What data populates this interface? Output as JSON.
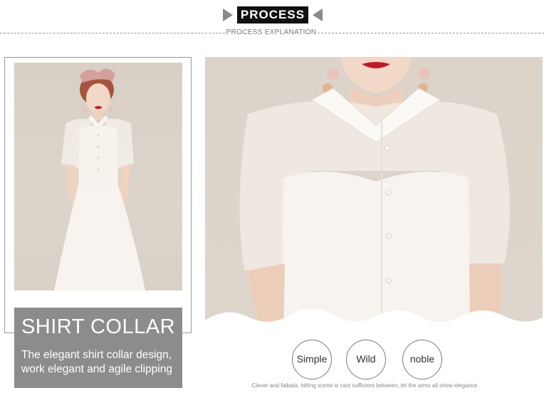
{
  "header": {
    "title": "PROCESS",
    "subtitle": "PROCESS EXPLANATION"
  },
  "feature": {
    "title": "SHIRT COLLAR",
    "description_lines": [
      "The elegant shirt collar design,",
      "work elegant and agile clipping"
    ]
  },
  "tags": [
    "Simple",
    "Wild",
    "noble"
  ],
  "footer": {
    "note": "Clever and falbala, hitting scene is cast sufficient between, let the arms all show elegance."
  },
  "colors": {
    "banner_bg": "#111111",
    "banner_wing": "#8a8a8a",
    "caption_bg": "#8c8c8c",
    "photo_bg": "#ddd5cc",
    "dress": "#f6f2ec",
    "lips": "#c0182a"
  },
  "images": {
    "left_photo": "model-full-body-white-dress",
    "right_photo": "close-up-shirt-collar-chiffon-sleeves"
  }
}
